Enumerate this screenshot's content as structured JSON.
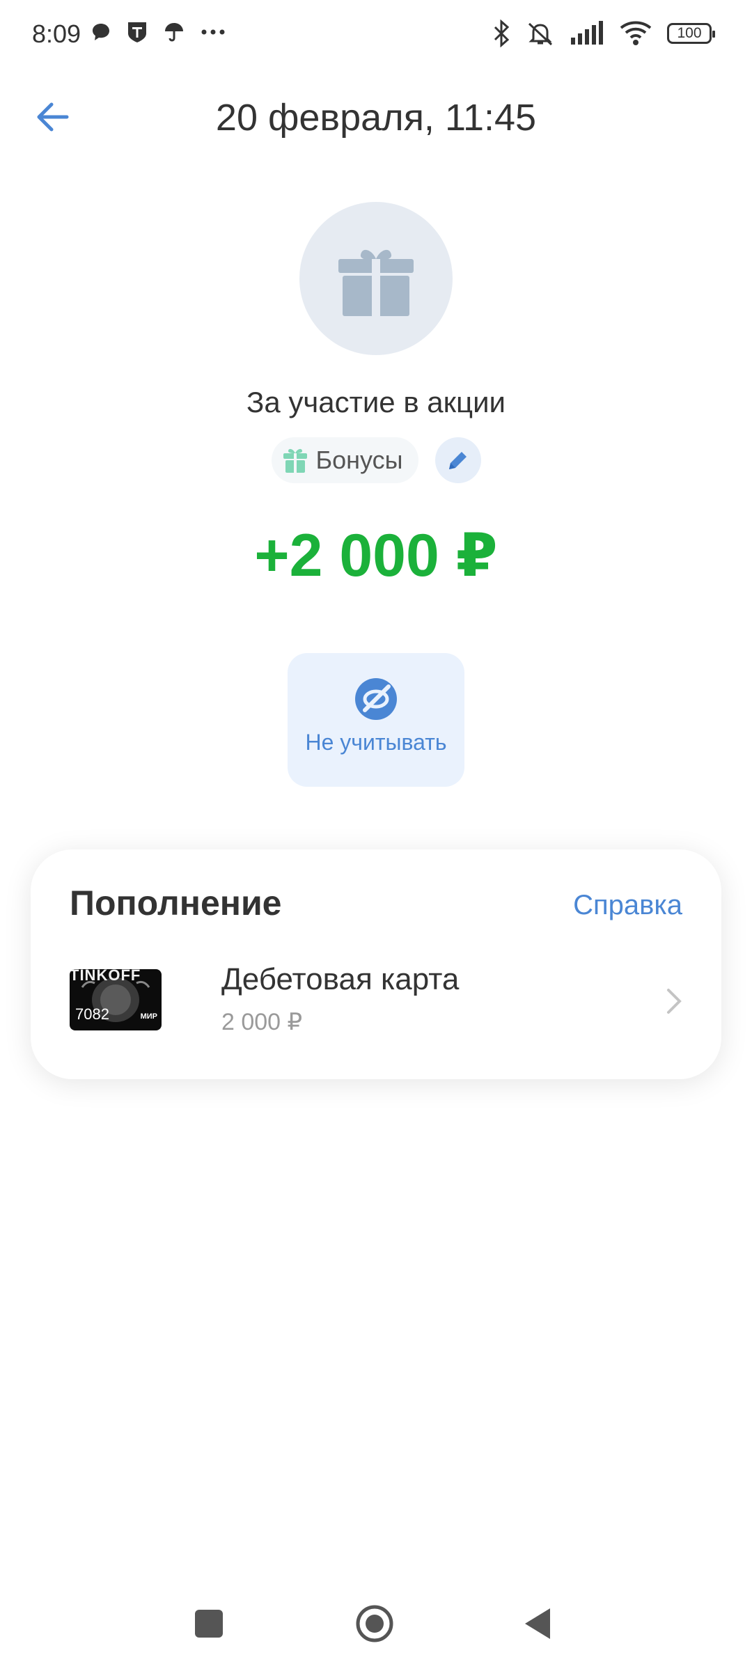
{
  "status_bar": {
    "time": "8:09",
    "battery": "100",
    "left_icons": [
      "chat-bubble-icon",
      "bank-t-icon",
      "umbrella-icon",
      "more-dots-icon"
    ],
    "right_icons": [
      "bluetooth-icon",
      "mute-bell-icon",
      "signal-icon",
      "wifi-icon",
      "battery-icon"
    ]
  },
  "header": {
    "title": "20 февраля, 11:45",
    "back_icon": "arrow-left-icon"
  },
  "operation": {
    "icon": "gift-icon",
    "description": "За участие в акции",
    "category": "Бонусы",
    "amount": "+2 000 ₽",
    "amount_color": "#1bb13a"
  },
  "actions": {
    "exclude_label": "Не учитывать"
  },
  "details": {
    "title": "Пополнение",
    "help_link": "Справка",
    "account": {
      "card_brand": "TINKOFF",
      "card_last_digits": "7082",
      "card_network": "МИР",
      "name": "Дебетовая карта",
      "amount": "2 000 ₽"
    }
  },
  "colors": {
    "accent": "#4a86d4",
    "positive": "#1bb13a",
    "hero_bg": "#e6ebf2",
    "tile_bg": "#eaf2fd"
  }
}
